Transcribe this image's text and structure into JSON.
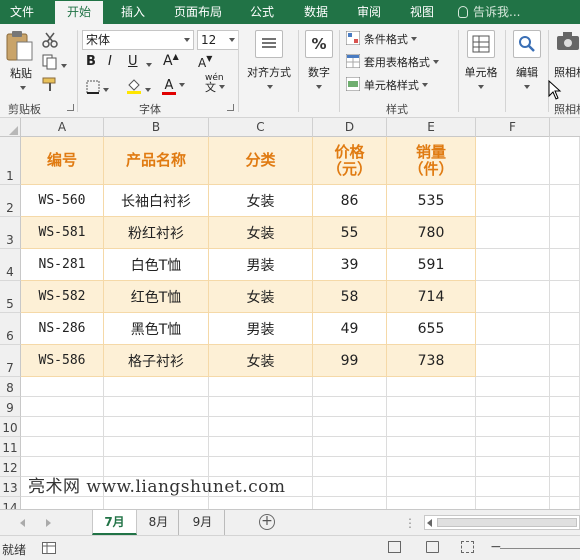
{
  "ribbon_tabs": [
    "文件",
    "开始",
    "插入",
    "页面布局",
    "公式",
    "数据",
    "审阅",
    "视图"
  ],
  "active_tab": "开始",
  "tell_me": "告诉我...",
  "clipboard": {
    "paste": "粘贴",
    "label": "剪贴板"
  },
  "font": {
    "name": "宋体",
    "size": "12",
    "bold": "B",
    "italic": "I",
    "underline": "U",
    "font_color_glyph": "A",
    "phonetic_glyph": "wén",
    "label": "字体"
  },
  "alignment": {
    "label": "对齐方式"
  },
  "number": {
    "icon": "%",
    "label": "数字"
  },
  "styles": {
    "items": [
      "条件格式",
      "套用表格格式",
      "单元格样式"
    ],
    "label": "样式"
  },
  "cells": {
    "label": "单元格"
  },
  "editing": {
    "label": "编辑"
  },
  "camera": {
    "label": "照相机",
    "group_label": "照相机"
  },
  "columns": [
    "A",
    "B",
    "C",
    "D",
    "E",
    "F"
  ],
  "rows": [
    "1",
    "2",
    "3",
    "4",
    "5",
    "6",
    "7",
    "8",
    "9",
    "10",
    "11",
    "12",
    "13",
    "14"
  ],
  "table": {
    "headers": [
      "编号",
      "产品名称",
      "分类",
      "价格\n（元）",
      "销量\n（件）"
    ],
    "rows": [
      [
        "WS-560",
        "长袖白衬衫",
        "女装",
        "86",
        "535"
      ],
      [
        "WS-581",
        "粉红衬衫",
        "女装",
        "55",
        "780"
      ],
      [
        "NS-281",
        "白色T恤",
        "男装",
        "39",
        "591"
      ],
      [
        "WS-582",
        "红色T恤",
        "女装",
        "58",
        "714"
      ],
      [
        "NS-286",
        "黑色T恤",
        "男装",
        "49",
        "655"
      ],
      [
        "WS-586",
        "格子衬衫",
        "女装",
        "99",
        "738"
      ]
    ]
  },
  "watermark": "亮术网 www.liangshunet.com",
  "sheet_tabs": [
    "7月",
    "8月",
    "9月"
  ],
  "active_sheet": "7月",
  "status": "就绪",
  "colors": {
    "accent": "#217346",
    "header_text": "#e07b12",
    "band_fill": "#fdf0d6",
    "plain_fill": "#ffffff"
  }
}
